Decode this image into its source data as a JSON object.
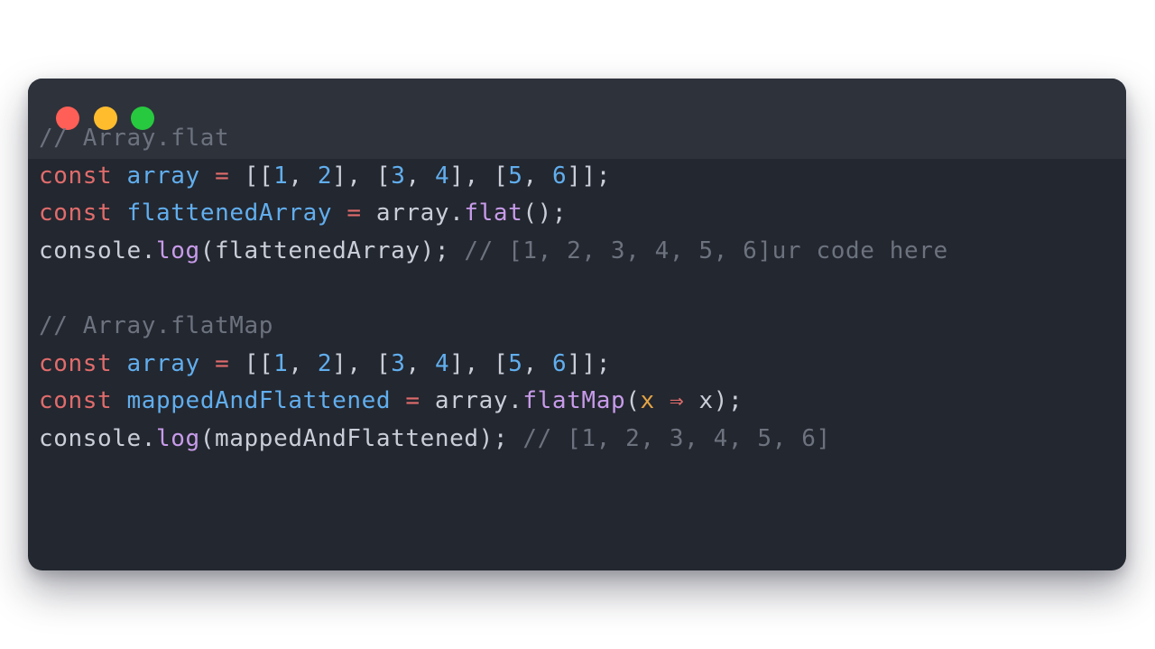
{
  "window": {
    "traffic_lights": [
      {
        "name": "close",
        "color": "#ff5f56"
      },
      {
        "name": "minimize",
        "color": "#ffbd2e"
      },
      {
        "name": "zoom",
        "color": "#27c93f"
      }
    ]
  },
  "code_lines": [
    [
      {
        "type": "comment",
        "text": "// Array.flat"
      }
    ],
    [
      {
        "type": "keyword",
        "text": "const"
      },
      {
        "type": "plain",
        "text": " "
      },
      {
        "type": "variable",
        "text": "array"
      },
      {
        "type": "plain",
        "text": " "
      },
      {
        "type": "operator",
        "text": "="
      },
      {
        "type": "plain",
        "text": " [["
      },
      {
        "type": "number",
        "text": "1"
      },
      {
        "type": "plain",
        "text": ", "
      },
      {
        "type": "number",
        "text": "2"
      },
      {
        "type": "plain",
        "text": "], ["
      },
      {
        "type": "number",
        "text": "3"
      },
      {
        "type": "plain",
        "text": ", "
      },
      {
        "type": "number",
        "text": "4"
      },
      {
        "type": "plain",
        "text": "], ["
      },
      {
        "type": "number",
        "text": "5"
      },
      {
        "type": "plain",
        "text": ", "
      },
      {
        "type": "number",
        "text": "6"
      },
      {
        "type": "plain",
        "text": "]];"
      }
    ],
    [
      {
        "type": "keyword",
        "text": "const"
      },
      {
        "type": "plain",
        "text": " "
      },
      {
        "type": "variable",
        "text": "flattenedArray"
      },
      {
        "type": "plain",
        "text": " "
      },
      {
        "type": "operator",
        "text": "="
      },
      {
        "type": "plain",
        "text": " array."
      },
      {
        "type": "function",
        "text": "flat"
      },
      {
        "type": "plain",
        "text": "();"
      }
    ],
    [
      {
        "type": "plain",
        "text": "console."
      },
      {
        "type": "function",
        "text": "log"
      },
      {
        "type": "plain",
        "text": "(flattenedArray); "
      },
      {
        "type": "comment",
        "text": "// [1, 2, 3, 4, 5, 6]ur code here"
      }
    ],
    [],
    [
      {
        "type": "comment",
        "text": "// Array.flatMap"
      }
    ],
    [
      {
        "type": "keyword",
        "text": "const"
      },
      {
        "type": "plain",
        "text": " "
      },
      {
        "type": "variable",
        "text": "array"
      },
      {
        "type": "plain",
        "text": " "
      },
      {
        "type": "operator",
        "text": "="
      },
      {
        "type": "plain",
        "text": " [["
      },
      {
        "type": "number",
        "text": "1"
      },
      {
        "type": "plain",
        "text": ", "
      },
      {
        "type": "number",
        "text": "2"
      },
      {
        "type": "plain",
        "text": "], ["
      },
      {
        "type": "number",
        "text": "3"
      },
      {
        "type": "plain",
        "text": ", "
      },
      {
        "type": "number",
        "text": "4"
      },
      {
        "type": "plain",
        "text": "], ["
      },
      {
        "type": "number",
        "text": "5"
      },
      {
        "type": "plain",
        "text": ", "
      },
      {
        "type": "number",
        "text": "6"
      },
      {
        "type": "plain",
        "text": "]];"
      }
    ],
    [
      {
        "type": "keyword",
        "text": "const"
      },
      {
        "type": "plain",
        "text": " "
      },
      {
        "type": "variable",
        "text": "mappedAndFlattened"
      },
      {
        "type": "plain",
        "text": " "
      },
      {
        "type": "operator",
        "text": "="
      },
      {
        "type": "plain",
        "text": " array."
      },
      {
        "type": "function",
        "text": "flatMap"
      },
      {
        "type": "plain",
        "text": "("
      },
      {
        "type": "param",
        "text": "x"
      },
      {
        "type": "plain",
        "text": " "
      },
      {
        "type": "operator",
        "text": "⇒"
      },
      {
        "type": "plain",
        "text": " x);"
      }
    ],
    [
      {
        "type": "plain",
        "text": "console."
      },
      {
        "type": "function",
        "text": "log"
      },
      {
        "type": "plain",
        "text": "(mappedAndFlattened); "
      },
      {
        "type": "comment",
        "text": "// [1, 2, 3, 4, 5, 6]"
      }
    ]
  ]
}
